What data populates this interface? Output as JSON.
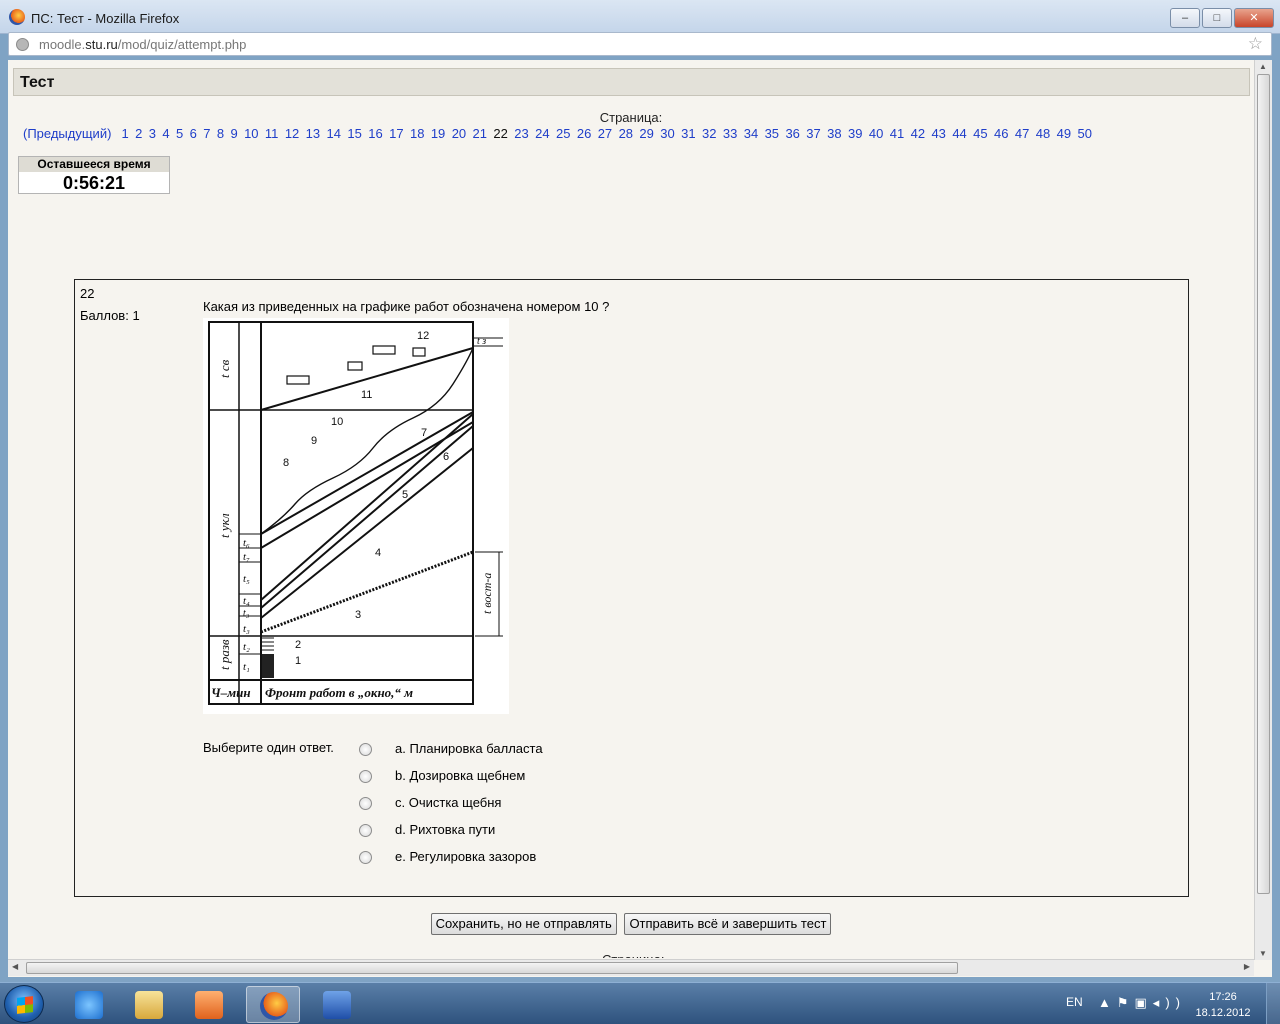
{
  "window": {
    "title": "ПС: Тест - Mozilla Firefox",
    "url_prefix": "moodle.",
    "url_domain": "stu.ru",
    "url_path": "/mod/quiz/attempt.php",
    "buttons": [
      "–",
      "□",
      "✕"
    ]
  },
  "header": {
    "title": "Тест"
  },
  "pagination": {
    "label": "Страница:",
    "prev": "(Предыдущий)",
    "pages": [
      "1",
      "2",
      "3",
      "4",
      "5",
      "6",
      "7",
      "8",
      "9",
      "10",
      "11",
      "12",
      "13",
      "14",
      "15",
      "16",
      "17",
      "18",
      "19",
      "20",
      "21",
      "22",
      "23",
      "24",
      "25",
      "26",
      "27",
      "28",
      "29",
      "30",
      "31",
      "32",
      "33",
      "34",
      "35",
      "36",
      "37",
      "38",
      "39",
      "40",
      "41",
      "42",
      "43",
      "44",
      "45",
      "46",
      "47",
      "48",
      "49",
      "50"
    ],
    "current": "22"
  },
  "timer": {
    "label": "Оставшееся время",
    "value": "0:56:21"
  },
  "question": {
    "number": "22",
    "score": "Баллов: 1",
    "text": "Какая из приведенных на графике работ обозначена номером 10 ?",
    "figure": {
      "bottom_left": "Ч–мин",
      "bottom_right": "Фронт работ в „окно,“ м",
      "numbers": [
        "1",
        "2",
        "3",
        "4",
        "5",
        "6",
        "7",
        "8",
        "9",
        "10",
        "11",
        "12"
      ],
      "left_labels": [
        "t_св",
        "t_укл",
        "t_разв",
        "t_6",
        "t_7",
        "t_5",
        "t_4",
        "t_3",
        "t_2",
        "t_1"
      ],
      "right_labels": [
        "t_з",
        "t_вост-а"
      ]
    },
    "answer_label": "Выберите один ответ.",
    "options": [
      "a. Планировка балласта",
      "b. Дозировка щебнем",
      "c. Очистка щебня",
      "d. Рихтовка пути",
      "e. Регулировка зазоров"
    ]
  },
  "buttons": {
    "save": "Сохранить, но не отправлять",
    "submit": "Отправить всё и завершить тест"
  },
  "bottom_label": "Страница:",
  "taskbar": {
    "lang": "EN",
    "time": "17:26",
    "date": "18.12.2012"
  }
}
